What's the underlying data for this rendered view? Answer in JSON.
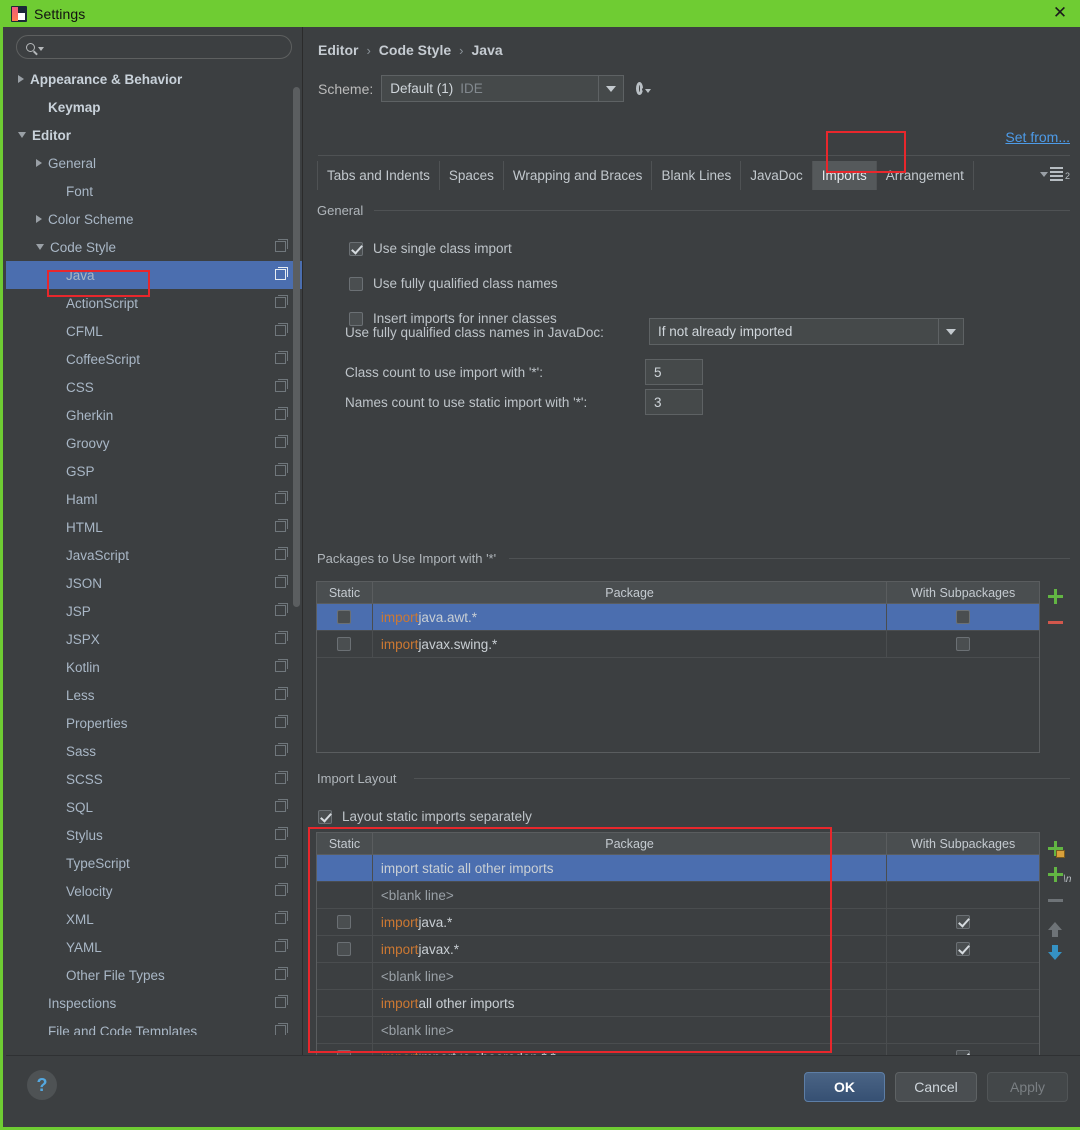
{
  "window": {
    "title": "Settings",
    "close_label": "✕",
    "icon": "intellij-logo-icon"
  },
  "sidebar": {
    "search": {
      "placeholder": "",
      "value": "",
      "icon": "search-icon"
    },
    "items": [
      {
        "label": "Appearance & Behavior",
        "indent": 0,
        "arrow": "right",
        "bold": true,
        "copy": false,
        "selected": false
      },
      {
        "label": "Keymap",
        "indent": 1,
        "arrow": "none",
        "bold": true,
        "copy": false,
        "selected": false
      },
      {
        "label": "Editor",
        "indent": 0,
        "arrow": "down",
        "bold": true,
        "copy": false,
        "selected": false
      },
      {
        "label": "General",
        "indent": 1,
        "arrow": "right",
        "bold": false,
        "copy": false,
        "selected": false
      },
      {
        "label": "Font",
        "indent": 2,
        "arrow": "none",
        "bold": false,
        "copy": false,
        "selected": false
      },
      {
        "label": "Color Scheme",
        "indent": 1,
        "arrow": "right",
        "bold": false,
        "copy": false,
        "selected": false
      },
      {
        "label": "Code Style",
        "indent": 1,
        "arrow": "down",
        "bold": false,
        "copy": true,
        "selected": false
      },
      {
        "label": "Java",
        "indent": 2,
        "arrow": "none",
        "bold": false,
        "copy": true,
        "selected": true
      },
      {
        "label": "ActionScript",
        "indent": 2,
        "arrow": "none",
        "bold": false,
        "copy": true,
        "selected": false
      },
      {
        "label": "CFML",
        "indent": 2,
        "arrow": "none",
        "bold": false,
        "copy": true,
        "selected": false
      },
      {
        "label": "CoffeeScript",
        "indent": 2,
        "arrow": "none",
        "bold": false,
        "copy": true,
        "selected": false
      },
      {
        "label": "CSS",
        "indent": 2,
        "arrow": "none",
        "bold": false,
        "copy": true,
        "selected": false
      },
      {
        "label": "Gherkin",
        "indent": 2,
        "arrow": "none",
        "bold": false,
        "copy": true,
        "selected": false
      },
      {
        "label": "Groovy",
        "indent": 2,
        "arrow": "none",
        "bold": false,
        "copy": true,
        "selected": false
      },
      {
        "label": "GSP",
        "indent": 2,
        "arrow": "none",
        "bold": false,
        "copy": true,
        "selected": false
      },
      {
        "label": "Haml",
        "indent": 2,
        "arrow": "none",
        "bold": false,
        "copy": true,
        "selected": false
      },
      {
        "label": "HTML",
        "indent": 2,
        "arrow": "none",
        "bold": false,
        "copy": true,
        "selected": false
      },
      {
        "label": "JavaScript",
        "indent": 2,
        "arrow": "none",
        "bold": false,
        "copy": true,
        "selected": false
      },
      {
        "label": "JSON",
        "indent": 2,
        "arrow": "none",
        "bold": false,
        "copy": true,
        "selected": false
      },
      {
        "label": "JSP",
        "indent": 2,
        "arrow": "none",
        "bold": false,
        "copy": true,
        "selected": false
      },
      {
        "label": "JSPX",
        "indent": 2,
        "arrow": "none",
        "bold": false,
        "copy": true,
        "selected": false
      },
      {
        "label": "Kotlin",
        "indent": 2,
        "arrow": "none",
        "bold": false,
        "copy": true,
        "selected": false
      },
      {
        "label": "Less",
        "indent": 2,
        "arrow": "none",
        "bold": false,
        "copy": true,
        "selected": false
      },
      {
        "label": "Properties",
        "indent": 2,
        "arrow": "none",
        "bold": false,
        "copy": true,
        "selected": false
      },
      {
        "label": "Sass",
        "indent": 2,
        "arrow": "none",
        "bold": false,
        "copy": true,
        "selected": false
      },
      {
        "label": "SCSS",
        "indent": 2,
        "arrow": "none",
        "bold": false,
        "copy": true,
        "selected": false
      },
      {
        "label": "SQL",
        "indent": 2,
        "arrow": "none",
        "bold": false,
        "copy": true,
        "selected": false
      },
      {
        "label": "Stylus",
        "indent": 2,
        "arrow": "none",
        "bold": false,
        "copy": true,
        "selected": false
      },
      {
        "label": "TypeScript",
        "indent": 2,
        "arrow": "none",
        "bold": false,
        "copy": true,
        "selected": false
      },
      {
        "label": "Velocity",
        "indent": 2,
        "arrow": "none",
        "bold": false,
        "copy": true,
        "selected": false
      },
      {
        "label": "XML",
        "indent": 2,
        "arrow": "none",
        "bold": false,
        "copy": true,
        "selected": false
      },
      {
        "label": "YAML",
        "indent": 2,
        "arrow": "none",
        "bold": false,
        "copy": true,
        "selected": false
      },
      {
        "label": "Other File Types",
        "indent": 2,
        "arrow": "none",
        "bold": false,
        "copy": true,
        "selected": false
      },
      {
        "label": "Inspections",
        "indent": 1,
        "arrow": "none",
        "bold": false,
        "copy": true,
        "selected": false
      },
      {
        "label": "File and Code Templates",
        "indent": 1,
        "arrow": "none",
        "bold": false,
        "copy": true,
        "selected": false
      }
    ]
  },
  "breadcrumb": {
    "parts": [
      "Editor",
      "Code Style",
      "Java"
    ],
    "separator": "›"
  },
  "scheme": {
    "label": "Scheme:",
    "value": "Default (1)",
    "scope": "IDE",
    "gear_icon": "gear-icon",
    "set_from_link": "Set from..."
  },
  "tabs": {
    "items": [
      {
        "label": "Tabs and Indents",
        "active": false
      },
      {
        "label": "Spaces",
        "active": false
      },
      {
        "label": "Wrapping and Braces",
        "active": false
      },
      {
        "label": "Blank Lines",
        "active": false
      },
      {
        "label": "JavaDoc",
        "active": false
      },
      {
        "label": "Imports",
        "active": true
      },
      {
        "label": "Arrangement",
        "active": false
      }
    ],
    "overflow_badge": "2"
  },
  "general": {
    "title": "General",
    "checkboxes": [
      {
        "label": "Use single class import",
        "checked": true
      },
      {
        "label": "Use fully qualified class names",
        "checked": false
      },
      {
        "label": "Insert imports for inner classes",
        "checked": false
      }
    ],
    "javadoc_label": "Use fully qualified class names in JavaDoc:",
    "javadoc_value": "If not already imported",
    "class_count_label": "Class count to use import with '*':",
    "class_count_value": "5",
    "names_count_label": "Names count to use static import with '*':",
    "names_count_value": "3"
  },
  "packages_table": {
    "title": "Packages to Use Import with '*'",
    "columns": [
      "Static",
      "Package",
      "With Subpackages"
    ],
    "rows": [
      {
        "static_cb": true,
        "static_checked": false,
        "keyword": "import",
        "text": " java.awt.*",
        "sub_cb": true,
        "sub_checked": false,
        "selected": true
      },
      {
        "static_cb": true,
        "static_checked": false,
        "keyword": "import",
        "text": " javax.swing.*",
        "sub_cb": true,
        "sub_checked": false,
        "selected": false
      }
    ],
    "toolbar": [
      {
        "name": "add-package-button",
        "icon": "plus-icon"
      },
      {
        "name": "remove-package-button",
        "icon": "minus-icon"
      }
    ]
  },
  "import_layout": {
    "title": "Import Layout",
    "checkbox": {
      "label": "Layout static imports separately",
      "checked": true
    },
    "columns": [
      "Static",
      "Package",
      "With Subpackages"
    ],
    "rows": [
      {
        "static_cb": false,
        "static_checked": false,
        "keyword": "",
        "text": "import static all other imports",
        "sub_cb": false,
        "sub_checked": false,
        "selected": true
      },
      {
        "static_cb": false,
        "static_checked": false,
        "keyword": "",
        "text": "<blank line>",
        "dim": true,
        "sub_cb": false,
        "sub_checked": false,
        "selected": false
      },
      {
        "static_cb": true,
        "static_checked": false,
        "keyword": "import",
        "text": " java.*",
        "sub_cb": true,
        "sub_checked": true,
        "selected": false
      },
      {
        "static_cb": true,
        "static_checked": false,
        "keyword": "import",
        "text": " javax.*",
        "sub_cb": true,
        "sub_checked": true,
        "selected": false
      },
      {
        "static_cb": false,
        "static_checked": false,
        "keyword": "",
        "text": "<blank line>",
        "dim": true,
        "sub_cb": false,
        "sub_checked": false,
        "selected": false
      },
      {
        "static_cb": false,
        "static_checked": false,
        "keyword": "import",
        "text": " all other imports",
        "sub_cb": false,
        "sub_checked": false,
        "selected": false
      },
      {
        "static_cb": false,
        "static_checked": false,
        "keyword": "",
        "text": "<blank line>",
        "dim": true,
        "sub_cb": false,
        "sub_checked": false,
        "selected": false
      },
      {
        "static_cb": true,
        "static_checked": false,
        "keyword": "import",
        "text": " import io.choerodon.*.*",
        "sub_cb": true,
        "sub_checked": true,
        "selected": false
      }
    ],
    "toolbar": [
      {
        "name": "add-package-entry-button",
        "icon": "plus-package-icon"
      },
      {
        "name": "add-blank-line-button",
        "icon": "plus-newline-icon"
      },
      {
        "name": "remove-entry-button",
        "icon": "minus-icon"
      },
      {
        "name": "move-up-button",
        "icon": "arrow-up-icon"
      },
      {
        "name": "move-down-button",
        "icon": "arrow-down-icon"
      }
    ]
  },
  "footer": {
    "help_label": "?",
    "ok_label": "OK",
    "cancel_label": "Cancel",
    "apply_label": "Apply"
  },
  "colors": {
    "titlebar": "#6fcc33",
    "accent_selection": "#4b6eaf",
    "keyword": "#cc7832",
    "link": "#4d9be8",
    "annotation": "#e8272c",
    "add": "#62b543",
    "remove": "#d2574c"
  }
}
